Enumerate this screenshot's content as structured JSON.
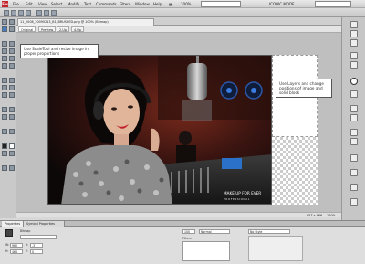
{
  "app": {
    "logo": "Fw"
  },
  "menu": [
    "File",
    "Edit",
    "View",
    "Select",
    "Modify",
    "Text",
    "Commands",
    "Filters",
    "Window",
    "Help"
  ],
  "toolbar": {
    "zoom": "100%",
    "mode": "ICONIC MODE"
  },
  "document": {
    "tab_title": "11_2008_20090213_B1_BRUSHED.png @ 100% (Bitmap)",
    "view_tabs": [
      "Original",
      "Preview",
      "2-Up",
      "4-Up"
    ]
  },
  "callouts": {
    "left": "Use ScaleTool and resize image in proper proportions",
    "right": "Use Layers and change positions of image and solid block"
  },
  "canvas": {
    "brand_line1": "MAKE UP FOR EVER",
    "brand_line2": "PROFESSIONAL"
  },
  "status": {
    "dimensions": "957 x 466",
    "zoom": "100%"
  },
  "properties": {
    "tabs": [
      "Properties",
      "Symbol Properties"
    ],
    "object_label": "Bitmap",
    "w_label": "W:",
    "w_value": "960",
    "h_label": "H:",
    "h_value": "466",
    "x_label": "X:",
    "x_value": "-3",
    "y_label": "Y:",
    "y_value": "0",
    "opacity": "100",
    "blend_mode": "Normal",
    "filters_label": "Filters",
    "style": "No Style"
  }
}
